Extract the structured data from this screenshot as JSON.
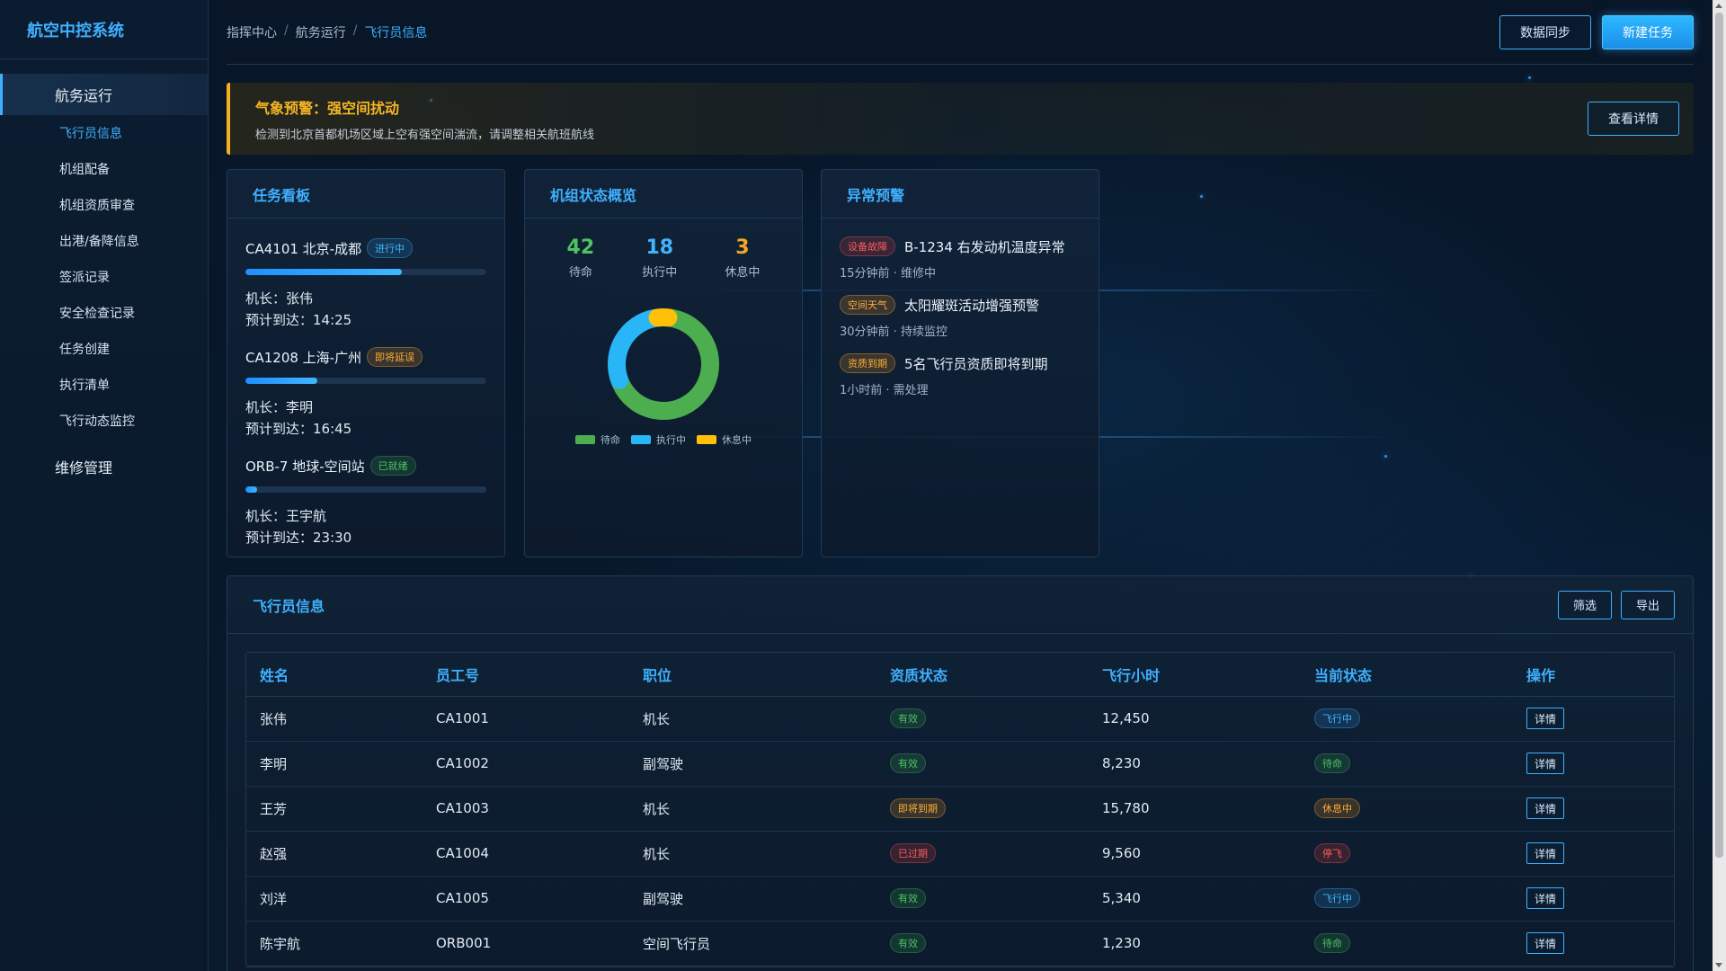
{
  "app": {
    "title": "航空中控系统"
  },
  "sidebar": {
    "groups": [
      {
        "label": "航务运行"
      },
      {
        "label": "维修管理"
      }
    ],
    "items": [
      {
        "label": "飞行员信息"
      },
      {
        "label": "机组配备"
      },
      {
        "label": "机组资质审查"
      },
      {
        "label": "出港/备降信息"
      },
      {
        "label": "签派记录"
      },
      {
        "label": "安全检查记录"
      },
      {
        "label": "任务创建"
      },
      {
        "label": "执行清单"
      },
      {
        "label": "飞行动态监控"
      }
    ]
  },
  "header": {
    "breadcrumb": [
      "指挥中心",
      "航务运行",
      "飞行员信息"
    ],
    "separator": "/",
    "sync_label": "数据同步",
    "new_task_label": "新建任务"
  },
  "alert": {
    "title": "气象预警：强空间扰动",
    "desc": "检测到北京首都机场区域上空有强空间湍流，请调整相关航班航线",
    "action_label": "查看详情",
    "color": "#f2b01e"
  },
  "task_board": {
    "title": "任务看板",
    "tasks": [
      {
        "name": "CA4101 北京-成都",
        "status": "进行中",
        "progress": 0.65,
        "captain": "机长：张伟",
        "eta": "预计到达：14:25"
      },
      {
        "name": "CA1208 上海-广州",
        "status": "即将延误",
        "progress": 0.3,
        "captain": "机长：李明",
        "eta": "预计到达：16:45"
      },
      {
        "name": "ORB-7 地球-空间站",
        "status": "已就绪",
        "progress": 0.05,
        "captain": "机长：王宇航",
        "eta": "预计到达：23:30"
      }
    ]
  },
  "crew_overview": {
    "title": "机组状态概览",
    "stats": [
      {
        "value": "42",
        "label": "待命",
        "color": "#4cc460"
      },
      {
        "value": "18",
        "label": "执行中",
        "color": "#40b6ff"
      },
      {
        "value": "3",
        "label": "休息中",
        "color": "#f5a623"
      }
    ],
    "legend": [
      "待命",
      "执行中",
      "休息中"
    ]
  },
  "chart_data": {
    "type": "pie",
    "categories": [
      "待命",
      "执行中",
      "休息中"
    ],
    "values": [
      42,
      18,
      3
    ],
    "colors": [
      "#4cae4f",
      "#29b6f6",
      "#ffc107"
    ],
    "donut": true
  },
  "anomalies": {
    "title": "异常预警",
    "items": [
      {
        "tag": "设备故障",
        "text": "B-1234 右发动机温度异常",
        "meta": "15分钟前 · 维修中"
      },
      {
        "tag": "空间天气",
        "text": "太阳耀斑活动增强预警",
        "meta": "30分钟前 · 持续监控"
      },
      {
        "tag": "资质到期",
        "text": "5名飞行员资质即将到期",
        "meta": "1小时前 · 需处理"
      }
    ]
  },
  "pilots": {
    "title": "飞行员信息",
    "filter_label": "筛选",
    "export_label": "导出",
    "columns": [
      "姓名",
      "员工号",
      "职位",
      "资质状态",
      "飞行小时",
      "当前状态",
      "操作"
    ],
    "detail_label": "详情",
    "rows": [
      {
        "name": "张伟",
        "id": "CA1001",
        "role": "机长",
        "qual": "有效",
        "hours": "12,450",
        "state": "飞行中"
      },
      {
        "name": "李明",
        "id": "CA1002",
        "role": "副驾驶",
        "qual": "有效",
        "hours": "8,230",
        "state": "待命"
      },
      {
        "name": "王芳",
        "id": "CA1003",
        "role": "机长",
        "qual": "即将到期",
        "hours": "15,780",
        "state": "休息中"
      },
      {
        "name": "赵强",
        "id": "CA1004",
        "role": "机长",
        "qual": "已过期",
        "hours": "9,560",
        "state": "停飞"
      },
      {
        "name": "刘洋",
        "id": "CA1005",
        "role": "副驾驶",
        "qual": "有效",
        "hours": "5,340",
        "state": "飞行中"
      },
      {
        "name": "陈宇航",
        "id": "ORB001",
        "role": "空间飞行员",
        "qual": "有效",
        "hours": "1,230",
        "state": "待命"
      }
    ]
  }
}
